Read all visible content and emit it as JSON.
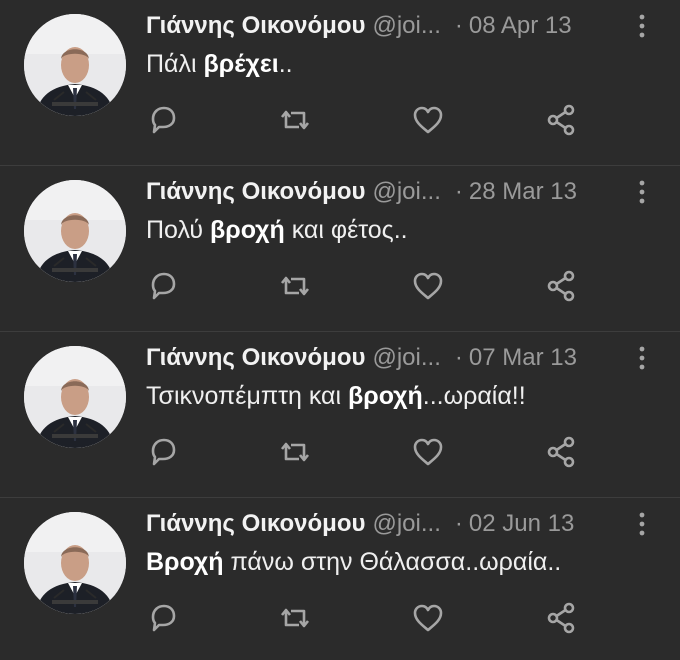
{
  "tweets": [
    {
      "name": "Γιάννης Οικονόμου",
      "handle": "@joi...",
      "separator": "·",
      "date": "08 Apr 13",
      "text_parts": [
        {
          "t": "Πάλι ",
          "b": false
        },
        {
          "t": "βρέχει",
          "b": true
        },
        {
          "t": "..",
          "b": false
        }
      ]
    },
    {
      "name": "Γιάννης Οικονόμου",
      "handle": "@joi...",
      "separator": "·",
      "date": "28 Mar 13",
      "text_parts": [
        {
          "t": "Πολύ ",
          "b": false
        },
        {
          "t": "βροχή",
          "b": true
        },
        {
          "t": " και φέτος..",
          "b": false
        }
      ]
    },
    {
      "name": "Γιάννης Οικονόμου",
      "handle": "@joi...",
      "separator": "·",
      "date": "07 Mar 13",
      "text_parts": [
        {
          "t": "Τσικνοπέμπτη και ",
          "b": false
        },
        {
          "t": "βροχή",
          "b": true
        },
        {
          "t": "...ωραία!!",
          "b": false
        }
      ]
    },
    {
      "name": "Γιάννης Οικονόμου",
      "handle": "@joi...",
      "separator": "·",
      "date": "02 Jun 13",
      "text_parts": [
        {
          "t": "Βροχή",
          "b": true
        },
        {
          "t": " πάνω στην Θάλασσα..ωραία..",
          "b": false
        }
      ]
    }
  ],
  "icons": {
    "avatar": "profile-photo",
    "more": "vertical-dots-icon",
    "reply": "reply-icon",
    "retweet": "retweet-icon",
    "like": "heart-icon",
    "share": "share-icon"
  },
  "colors": {
    "background": "#2b2b2b",
    "divider": "#3d3d3d",
    "icon": "#a6a6a6",
    "muted_text": "#9a9a9a"
  }
}
